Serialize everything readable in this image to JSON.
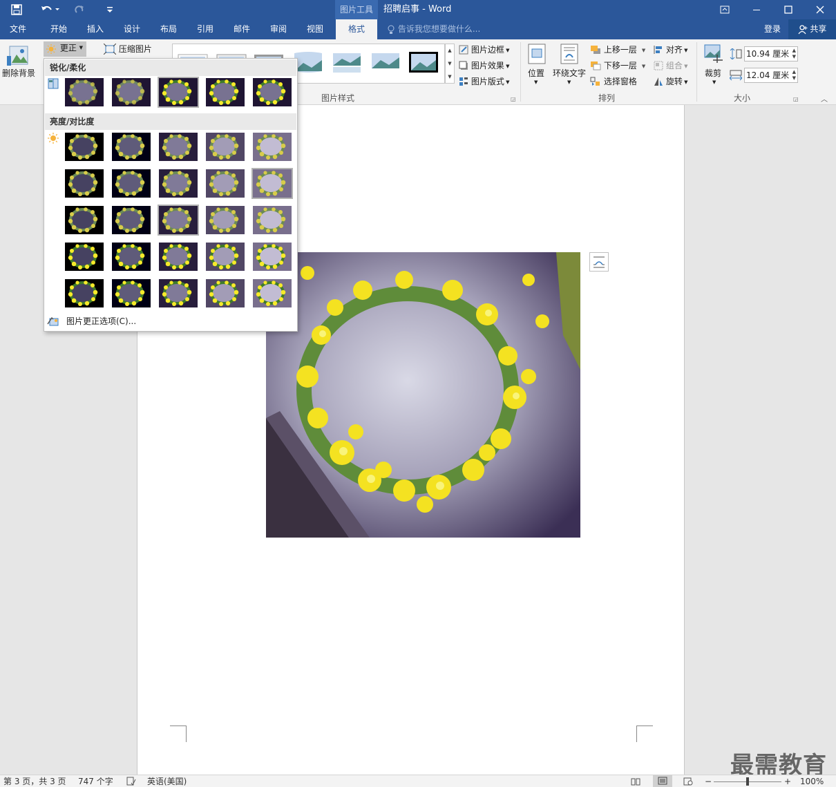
{
  "titlebar": {
    "context_tool": "图片工具",
    "doc_title": "招聘启事 - Word",
    "icons": [
      "save-icon",
      "undo-icon",
      "redo-icon",
      "customize-icon",
      "restore-ribbon-icon",
      "minimize-icon",
      "maximize-icon",
      "close-icon"
    ]
  },
  "tabs": {
    "file": "文件",
    "home": "开始",
    "insert": "插入",
    "design": "设计",
    "layout": "布局",
    "references": "引用",
    "mailings": "邮件",
    "review": "审阅",
    "view": "视图",
    "format": "格式",
    "tell_me": "告诉我您想要做什么...",
    "login": "登录",
    "share": "共享"
  },
  "ribbon": {
    "remove_bg": "删除背景",
    "corrections": "更正",
    "compress": "压缩图片",
    "styles_group": "图片样式",
    "picture_border": "图片边框",
    "picture_effects": "图片效果",
    "picture_layout": "图片版式",
    "position": "位置",
    "wrap_text": "环绕文字",
    "bring_forward": "上移一层",
    "send_backward": "下移一层",
    "selection_pane": "选择窗格",
    "align": "对齐",
    "group": "组合",
    "rotate": "旋转",
    "arrange_group": "排列",
    "crop": "裁剪",
    "height": "10.94 厘米",
    "width": "12.04 厘米",
    "size_group": "大小"
  },
  "dropdown": {
    "sharpen_header": "锐化/柔化",
    "brightness_header": "亮度/对比度",
    "options": "图片更正选项(C)...",
    "sharpen_selected": 2,
    "brightness_selected": [
      [
        1,
        4
      ],
      [
        2,
        2
      ]
    ]
  },
  "watermark": "最需教育",
  "status": {
    "page": "第 3 页，共 3 页",
    "words": "747 个字",
    "language": "英语(美国)",
    "zoom": "100%",
    "zoom_level": 1.0
  }
}
